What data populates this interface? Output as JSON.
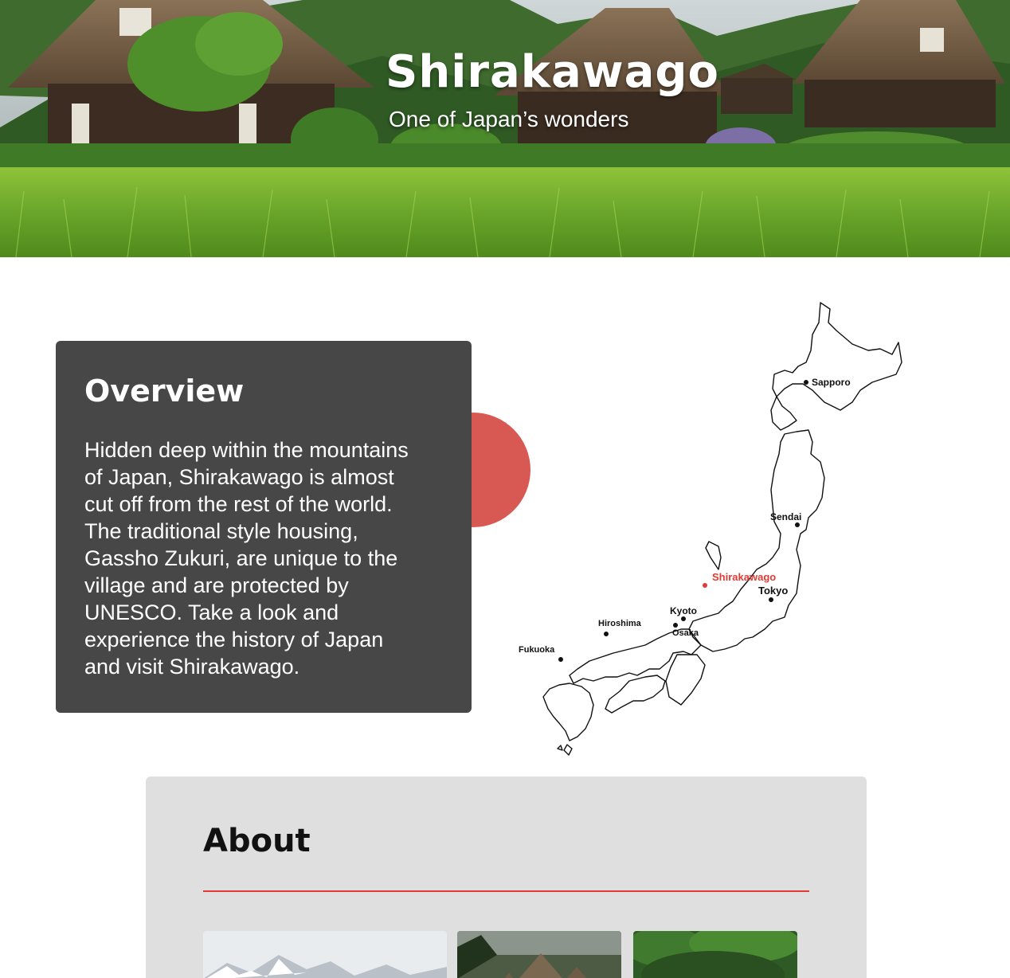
{
  "hero": {
    "title": "Shirakawago",
    "subtitle": "One of Japan’s wonders"
  },
  "overview": {
    "heading": "Overview",
    "lines": [
      "Hidden deep within the mountains",
      "of Japan, Shirakawago is almost",
      "cut off from the rest of the world.",
      "The traditional style housing,",
      "Gassho Zukuri, are unique to the",
      "village and are protected by",
      "UNESCO. Take a look and",
      "experience the history of Japan",
      "and visit Shirakawago."
    ]
  },
  "map": {
    "cities": {
      "sapporo": "Sapporo",
      "sendai": "Sendai",
      "shirakawago": "Shirakawago",
      "tokyo": "Tokyo",
      "kyoto": "Kyoto",
      "hiroshima": "Hiroshima",
      "osaka": "Osaka",
      "fukuoka": "Fukuoka"
    },
    "highlight_color": "#e03b35"
  },
  "about": {
    "heading": "About"
  },
  "colors": {
    "accent": "#d85854",
    "card_dark": "#474747",
    "card_light": "#dfdfdf"
  }
}
